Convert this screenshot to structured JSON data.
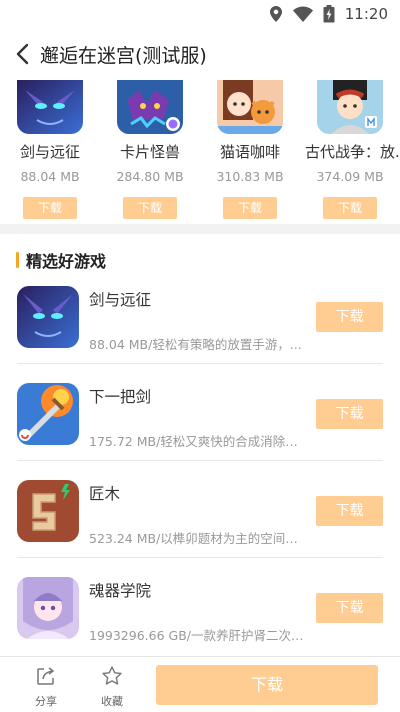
{
  "status": {
    "time": "11:20"
  },
  "header": {
    "title": "邂逅在迷宫(测试服)"
  },
  "top_apps": [
    {
      "name": "剑与远征",
      "size": "88.04 MB",
      "button": "下载"
    },
    {
      "name": "卡片怪兽",
      "size": "284.80 MB",
      "button": "下载"
    },
    {
      "name": "猫语咖啡",
      "size": "310.83 MB",
      "button": "下载"
    },
    {
      "name": "古代战争：放...",
      "size": "374.09 MB",
      "button": "下载"
    }
  ],
  "section": {
    "title": "精选好游戏"
  },
  "list": [
    {
      "name": "剑与远征",
      "desc": "88.04 MB/轻松有策略的放置手游，...",
      "button": "下载"
    },
    {
      "name": "下一把剑",
      "desc": "175.72 MB/轻松又爽快的合成消除+R...",
      "button": "下载"
    },
    {
      "name": "匠木",
      "desc": "523.24 MB/以榫卯题材为主的空间解...",
      "button": "下载"
    },
    {
      "name": "魂器学院",
      "desc": "1993296.66 GB/一款养肝护肾二次元...",
      "button": "下载"
    }
  ],
  "bottom": {
    "share": "分享",
    "favorite": "收藏",
    "download": "下载"
  }
}
